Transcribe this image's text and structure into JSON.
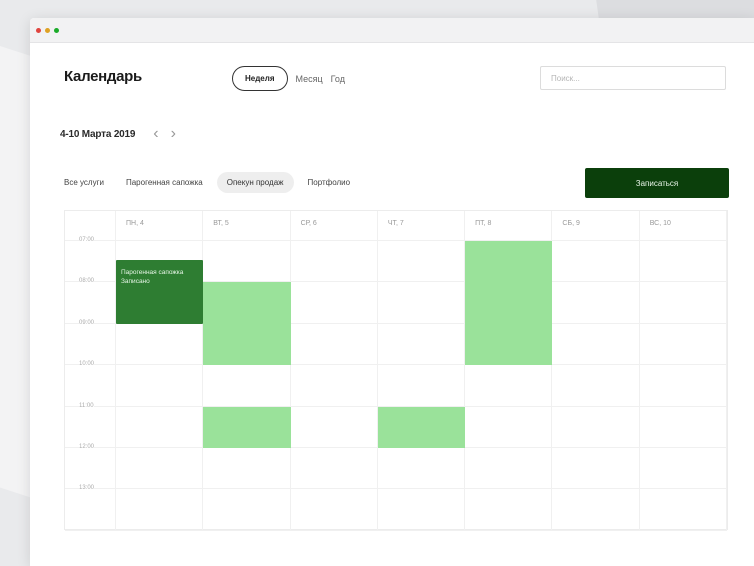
{
  "app": {
    "title": "Календарь"
  },
  "views": {
    "week": "Неделя",
    "month": "Месяц",
    "year": "Год"
  },
  "search": {
    "placeholder": "Поиск..."
  },
  "date_nav": {
    "range": "4-10 Марта 2019",
    "prev_icon": "chevron-left-icon",
    "next_icon": "chevron-right-icon"
  },
  "filters": [
    "Все услуги",
    "Парогенная сапожка",
    "Опекун продаж",
    "Портфолио"
  ],
  "active_filter_index": 2,
  "actions": {
    "record": "Записаться"
  },
  "calendar": {
    "days": [
      "ПН, 4",
      "ВТ, 5",
      "СР, 6",
      "ЧТ, 7",
      "ПТ, 8",
      "СБ, 9",
      "ВС, 10"
    ],
    "times": [
      "07:00",
      "08:00",
      "09:00",
      "10:00",
      "11:00",
      "12:00",
      "13:00"
    ],
    "events": [
      {
        "type": "booked",
        "day": 0,
        "start_hour": 0.45,
        "duration_hours": 1.55,
        "label": "Парогенная сапожка Записано"
      },
      {
        "type": "free",
        "day": 1,
        "start_hour": 1.0,
        "duration_hours": 2.0,
        "label": ""
      },
      {
        "type": "free",
        "day": 4,
        "start_hour": 0.0,
        "duration_hours": 3.0,
        "label": ""
      },
      {
        "type": "free",
        "day": 1,
        "start_hour": 4.0,
        "duration_hours": 1.0,
        "label": ""
      },
      {
        "type": "free",
        "day": 3,
        "start_hour": 4.0,
        "duration_hours": 1.0,
        "label": ""
      }
    ]
  },
  "colors": {
    "booked": "#2e7d32",
    "free": "#9ae29a",
    "primary_button": "#0b3f0b"
  }
}
